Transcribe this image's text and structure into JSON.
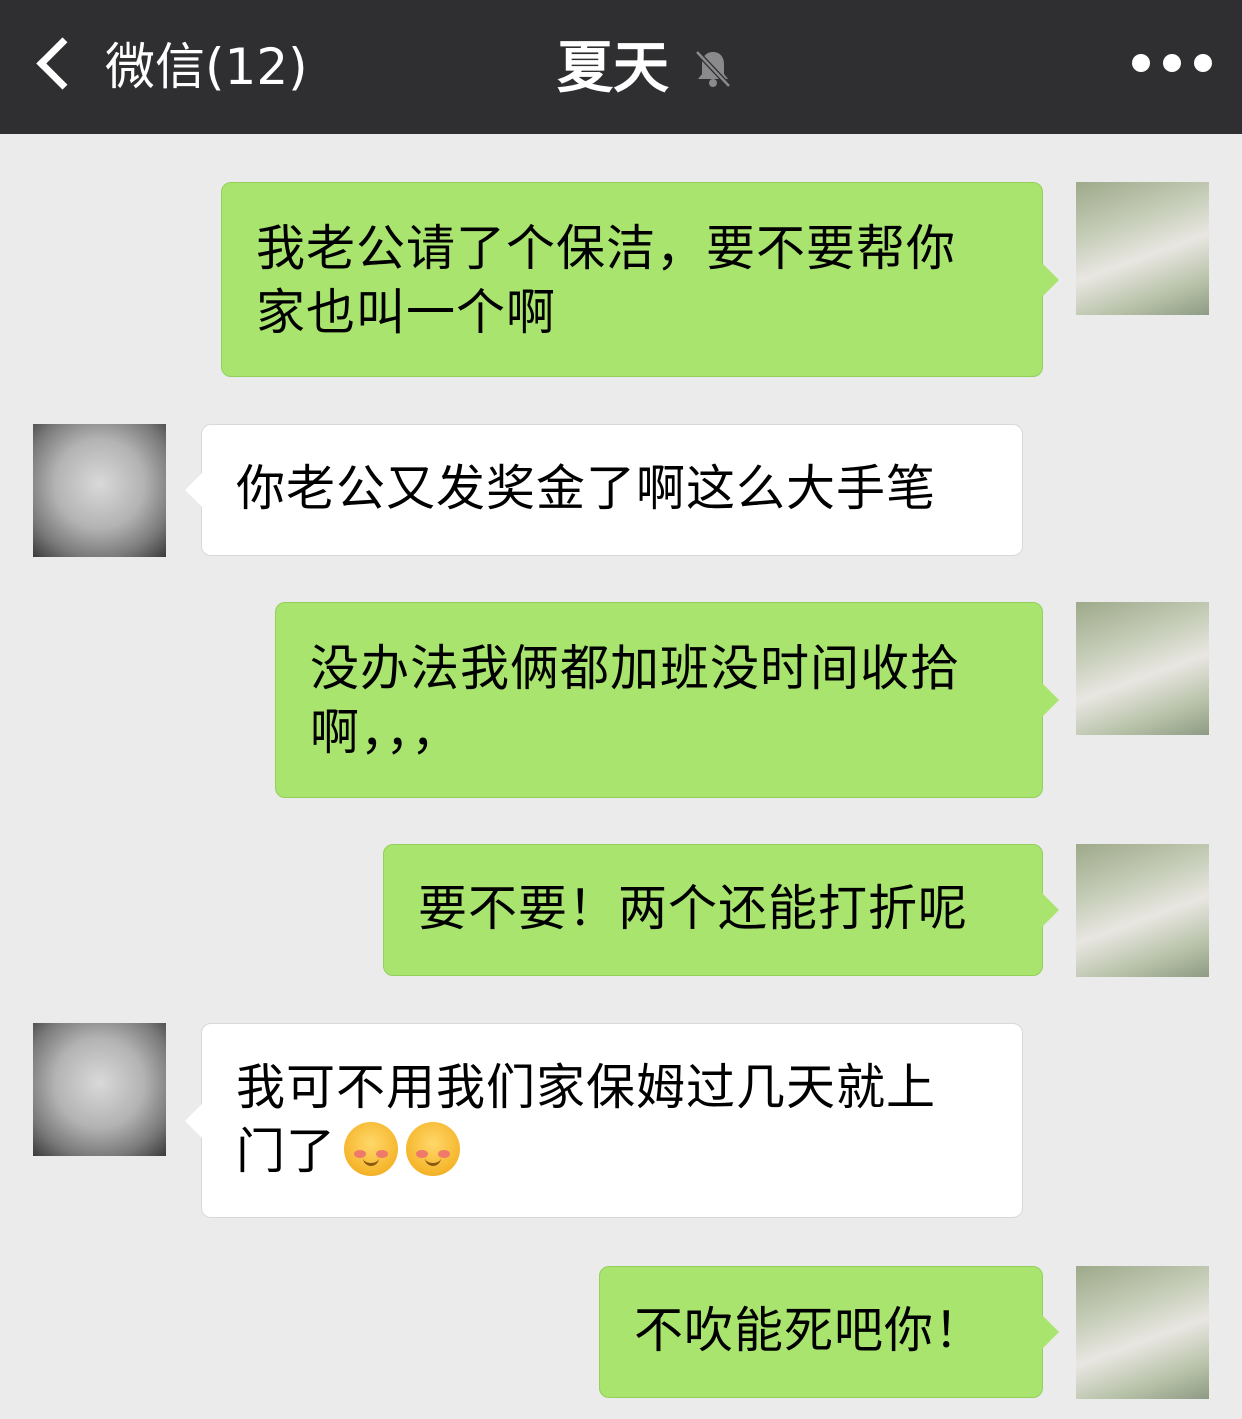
{
  "header": {
    "back_label": "微信(12)",
    "title": "夏天",
    "mute_icon": "bell-off-icon",
    "more_icon": "more-dots-icon"
  },
  "messages": [
    {
      "side": "self",
      "text": "我老公请了个保洁，要不要帮你\n家也叫一个啊"
    },
    {
      "side": "other",
      "text": "你老公又发奖金了啊这么大手笔"
    },
    {
      "side": "self",
      "text": "没办法我俩都加班没时间收拾\n啊，，，"
    },
    {
      "side": "self",
      "text": "要不要！两个还能打折呢"
    },
    {
      "side": "other",
      "text": "我可不用我们家保姆过几天就上\n门了",
      "emojis": [
        "blush-emoji",
        "blush-emoji"
      ]
    },
    {
      "side": "self",
      "text": "不吹能死吧你！"
    }
  ],
  "colors": {
    "topbar": "#2f2f31",
    "background": "#ebebeb",
    "self_bubble": "#a9e46f",
    "other_bubble": "#ffffff"
  }
}
